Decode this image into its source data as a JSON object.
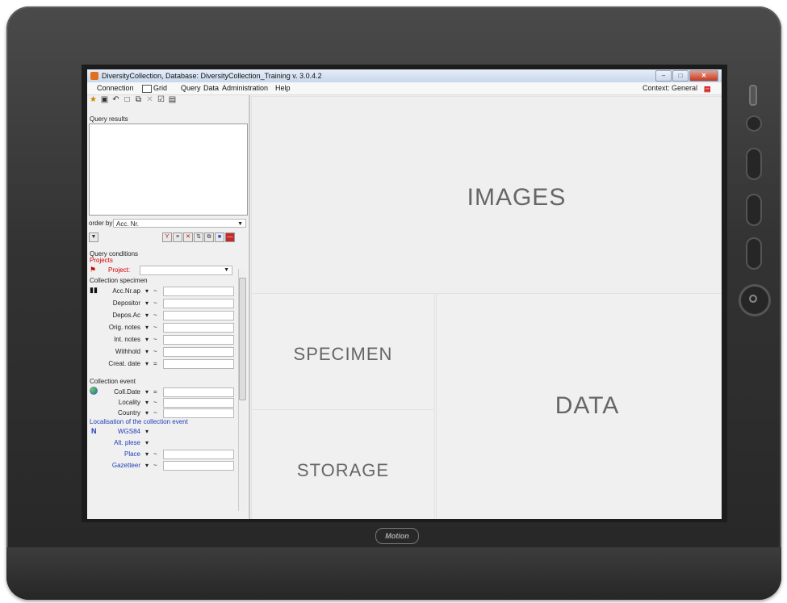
{
  "window": {
    "title": "DiversityCollection,  Database: DiversityCollection_Training    v. 3.0.4.2"
  },
  "menu": {
    "items": [
      "Connection",
      "Grid",
      "Query",
      "Data",
      "Administration",
      "Help"
    ],
    "context_label": "Context: General"
  },
  "left": {
    "query_results_label": "Query results",
    "order_by_label": "order by:",
    "order_by_value": "Acc. Nr.",
    "query_conditions_label": "Query conditions",
    "projects_label": "Projects",
    "project_field_label": "Project:",
    "collection_specimen_label": "Collection specimen",
    "specimen_fields": [
      {
        "label": "Acc.Nr.ap",
        "op1": "▾",
        "op2": "~"
      },
      {
        "label": "Depositor",
        "op1": "▾",
        "op2": "~"
      },
      {
        "label": "Depos.Ac",
        "op1": "▾",
        "op2": "~"
      },
      {
        "label": "Orig. notes",
        "op1": "▾",
        "op2": "~"
      },
      {
        "label": "Int. notes",
        "op1": "▾",
        "op2": "~"
      },
      {
        "label": "Withhold",
        "op1": "▾",
        "op2": "~"
      },
      {
        "label": "Creat. date",
        "op1": "▾",
        "op2": "="
      }
    ],
    "collection_event_label": "Collection event",
    "event_fields": [
      {
        "label": "Coll.Date",
        "op1": "▾",
        "op2": "="
      },
      {
        "label": "Locality",
        "op1": "▾",
        "op2": "~"
      },
      {
        "label": "Country",
        "op1": "▾",
        "op2": "~"
      }
    ],
    "localisation_label": "Localisation of the collection event",
    "localisation_fields": [
      {
        "label": "WGS84",
        "op1": "▾",
        "op2": ""
      },
      {
        "label": "Alt. plese",
        "op1": "▾",
        "op2": ""
      },
      {
        "label": "Place",
        "op1": "▾",
        "op2": "~"
      },
      {
        "label": "Gazetteer",
        "op1": "▾",
        "op2": "~"
      }
    ]
  },
  "main": {
    "images_label": "IMAGES",
    "specimen_label": "SPECIMEN",
    "storage_label": "STORAGE",
    "data_label": "DATA"
  },
  "device": {
    "logo_text": "Motion"
  }
}
